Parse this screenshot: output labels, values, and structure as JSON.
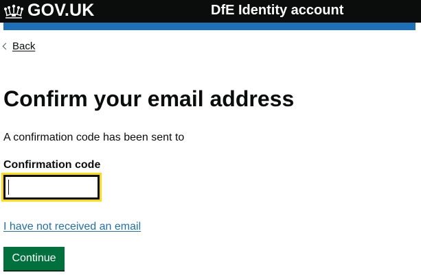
{
  "header": {
    "brand": "GOV.UK",
    "service_name": "DfE Identity account",
    "logo_icon": "crown-icon",
    "accent_color": "#1d70b8"
  },
  "nav": {
    "back_label": "Back",
    "back_icon": "chevron-left-icon"
  },
  "main": {
    "title": "Confirm your email address",
    "intro": "A confirmation code has been sent to",
    "code_label": "Confirmation code",
    "code_value": "",
    "resend_link": "I have not received an email",
    "continue_label": "Continue",
    "button_color": "#00703c",
    "focus_color": "#ffdd00"
  }
}
